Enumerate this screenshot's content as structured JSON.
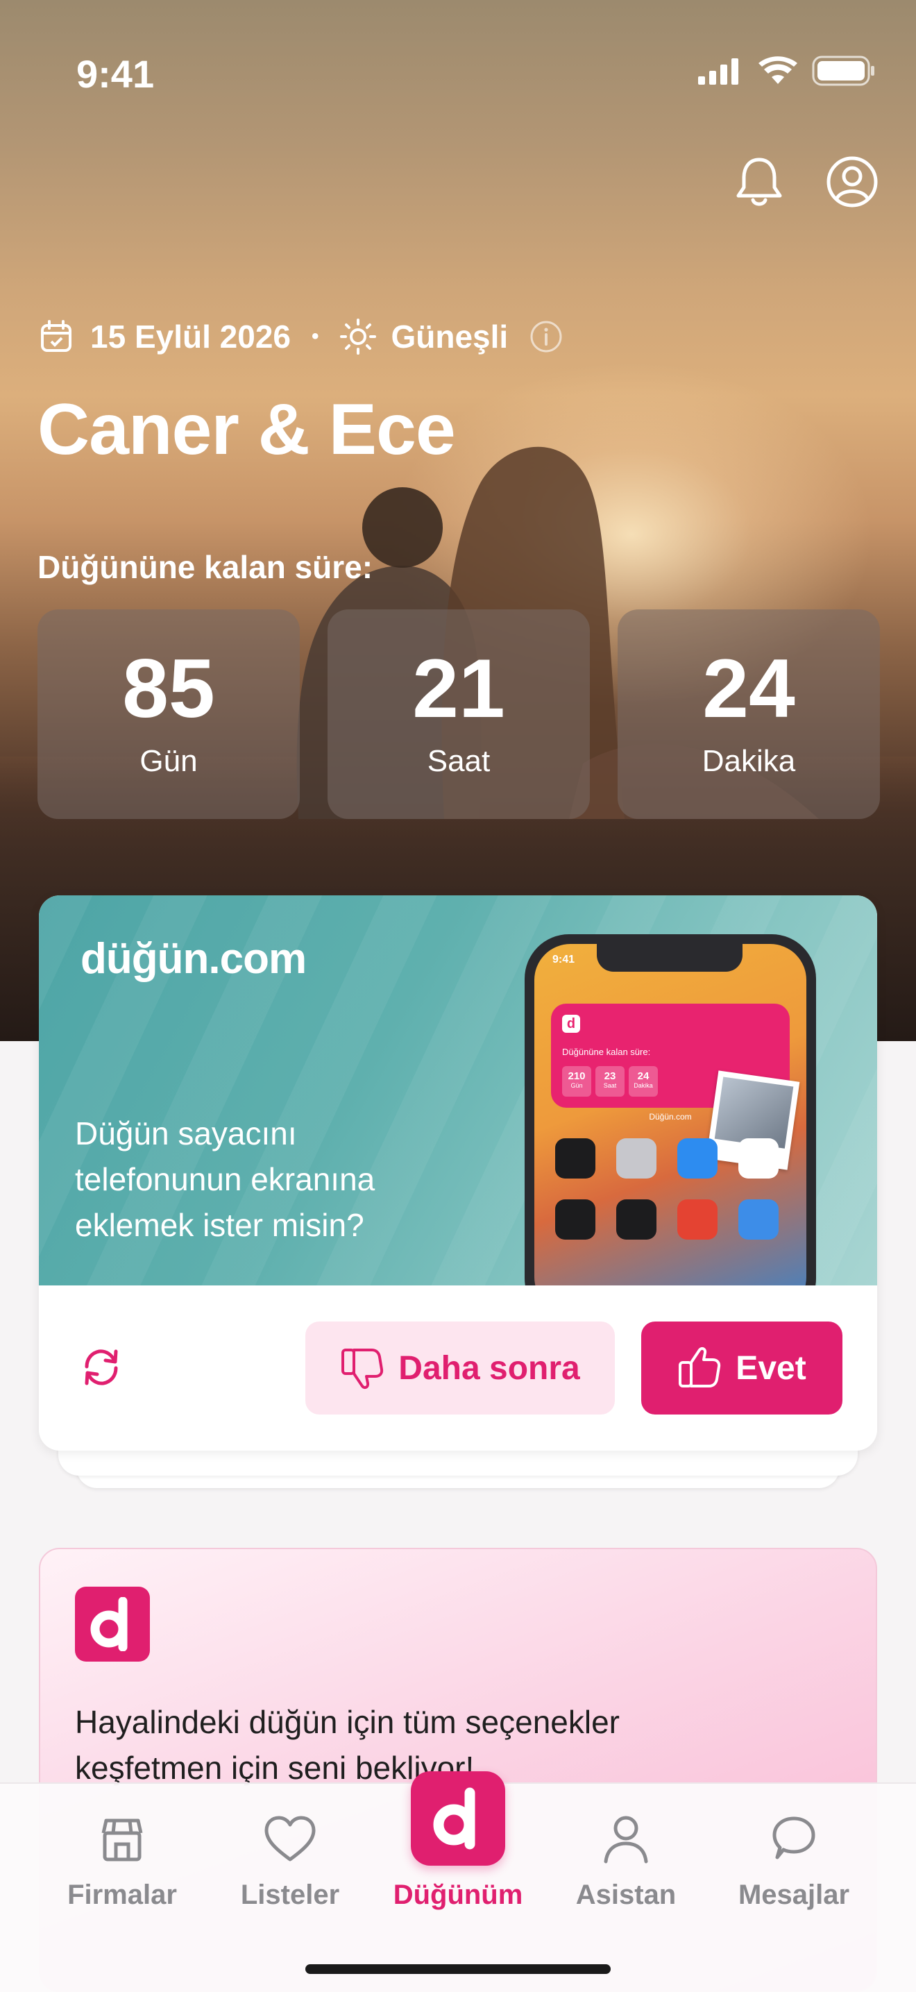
{
  "status_bar": {
    "time": "9:41"
  },
  "header": {
    "date": "15 Eylül 2026",
    "separator": "•",
    "weather": "Güneşli",
    "couple_names": "Caner & Ece"
  },
  "countdown": {
    "label": "Düğününe kalan süre:",
    "items": [
      {
        "value": "85",
        "unit": "Gün"
      },
      {
        "value": "21",
        "unit": "Saat"
      },
      {
        "value": "24",
        "unit": "Dakika"
      }
    ]
  },
  "promo": {
    "brand": "düğün.com",
    "text": "Düğün sayacını telefonunun ekranına eklemek ister misin?",
    "later_label": "Daha sonra",
    "yes_label": "Evet",
    "phone": {
      "time": "9:41",
      "widget_title": "Düğününe kalan süre:",
      "widget_values": [
        {
          "value": "210",
          "unit": "Gün"
        },
        {
          "value": "23",
          "unit": "Saat"
        },
        {
          "value": "24",
          "unit": "Dakika"
        }
      ],
      "caption": "Düğün.com"
    }
  },
  "info_card": {
    "text": "Hayalindeki düğün için tüm seçenekler keşfetmen için seni bekliyor!"
  },
  "tabbar": {
    "items": [
      {
        "label": "Firmalar",
        "icon": "store-icon"
      },
      {
        "label": "Listeler",
        "icon": "heart-icon"
      },
      {
        "label": "Düğünüm",
        "icon": "brand-d-icon",
        "active": true
      },
      {
        "label": "Asistan",
        "icon": "person-icon"
      },
      {
        "label": "Mesajlar",
        "icon": "chat-bubble-icon"
      }
    ]
  },
  "colors": {
    "accent": "#e01f6f",
    "accent_light": "#fde5ef",
    "teal": "#5fb0ae"
  }
}
